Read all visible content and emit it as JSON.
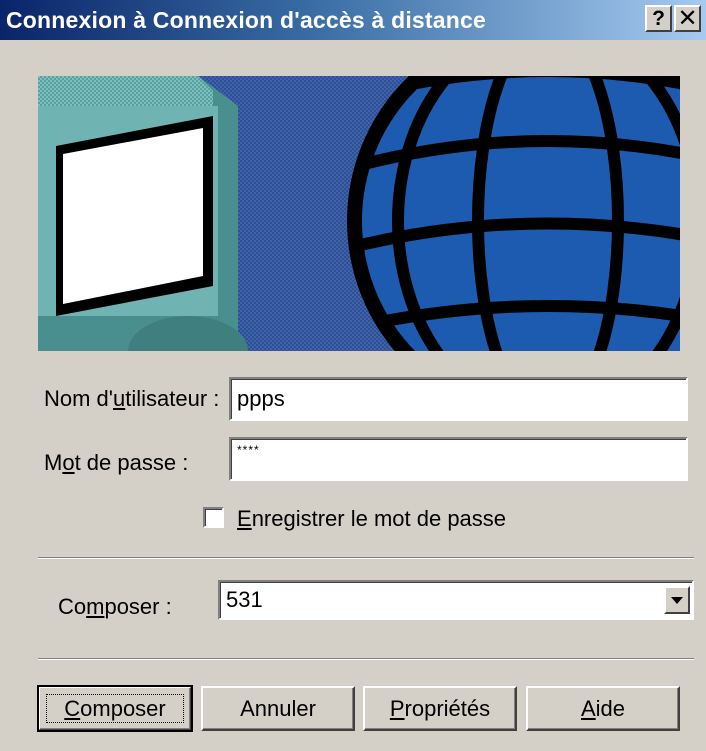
{
  "window": {
    "title": "Connexion à Connexion d'accès à distance",
    "help_glyph": "?",
    "close_glyph": "✕"
  },
  "form": {
    "username_label_pre": "Nom d'",
    "username_label_u": "u",
    "username_label_post": "tilisateur :",
    "username_value": "ppps",
    "password_label_pre": "M",
    "password_label_u": "o",
    "password_label_post": "t de passe :",
    "password_value": "****",
    "save_password_label_u": "E",
    "save_password_label_post": "nregistrer le mot de passe",
    "save_password_checked": false,
    "dial_label_pre": "Co",
    "dial_label_u": "m",
    "dial_label_post": "poser :",
    "dial_value": "531"
  },
  "buttons": {
    "dial_u": "C",
    "dial_post": "omposer",
    "cancel": "Annuler",
    "properties_u": "P",
    "properties_post": "ropriétés",
    "help_u": "A",
    "help_post": "ide"
  },
  "colors": {
    "titlebar_start": "#0a246a",
    "titlebar_end": "#a6caf0",
    "dialog_bg": "#d4d0c8",
    "globe": "#1c5bb0",
    "monitor": "#6fb3b3"
  },
  "icons": {
    "banner": "dialup-network-banner",
    "help": "help-icon",
    "close": "close-icon",
    "dropdown": "chevron-down-icon"
  }
}
